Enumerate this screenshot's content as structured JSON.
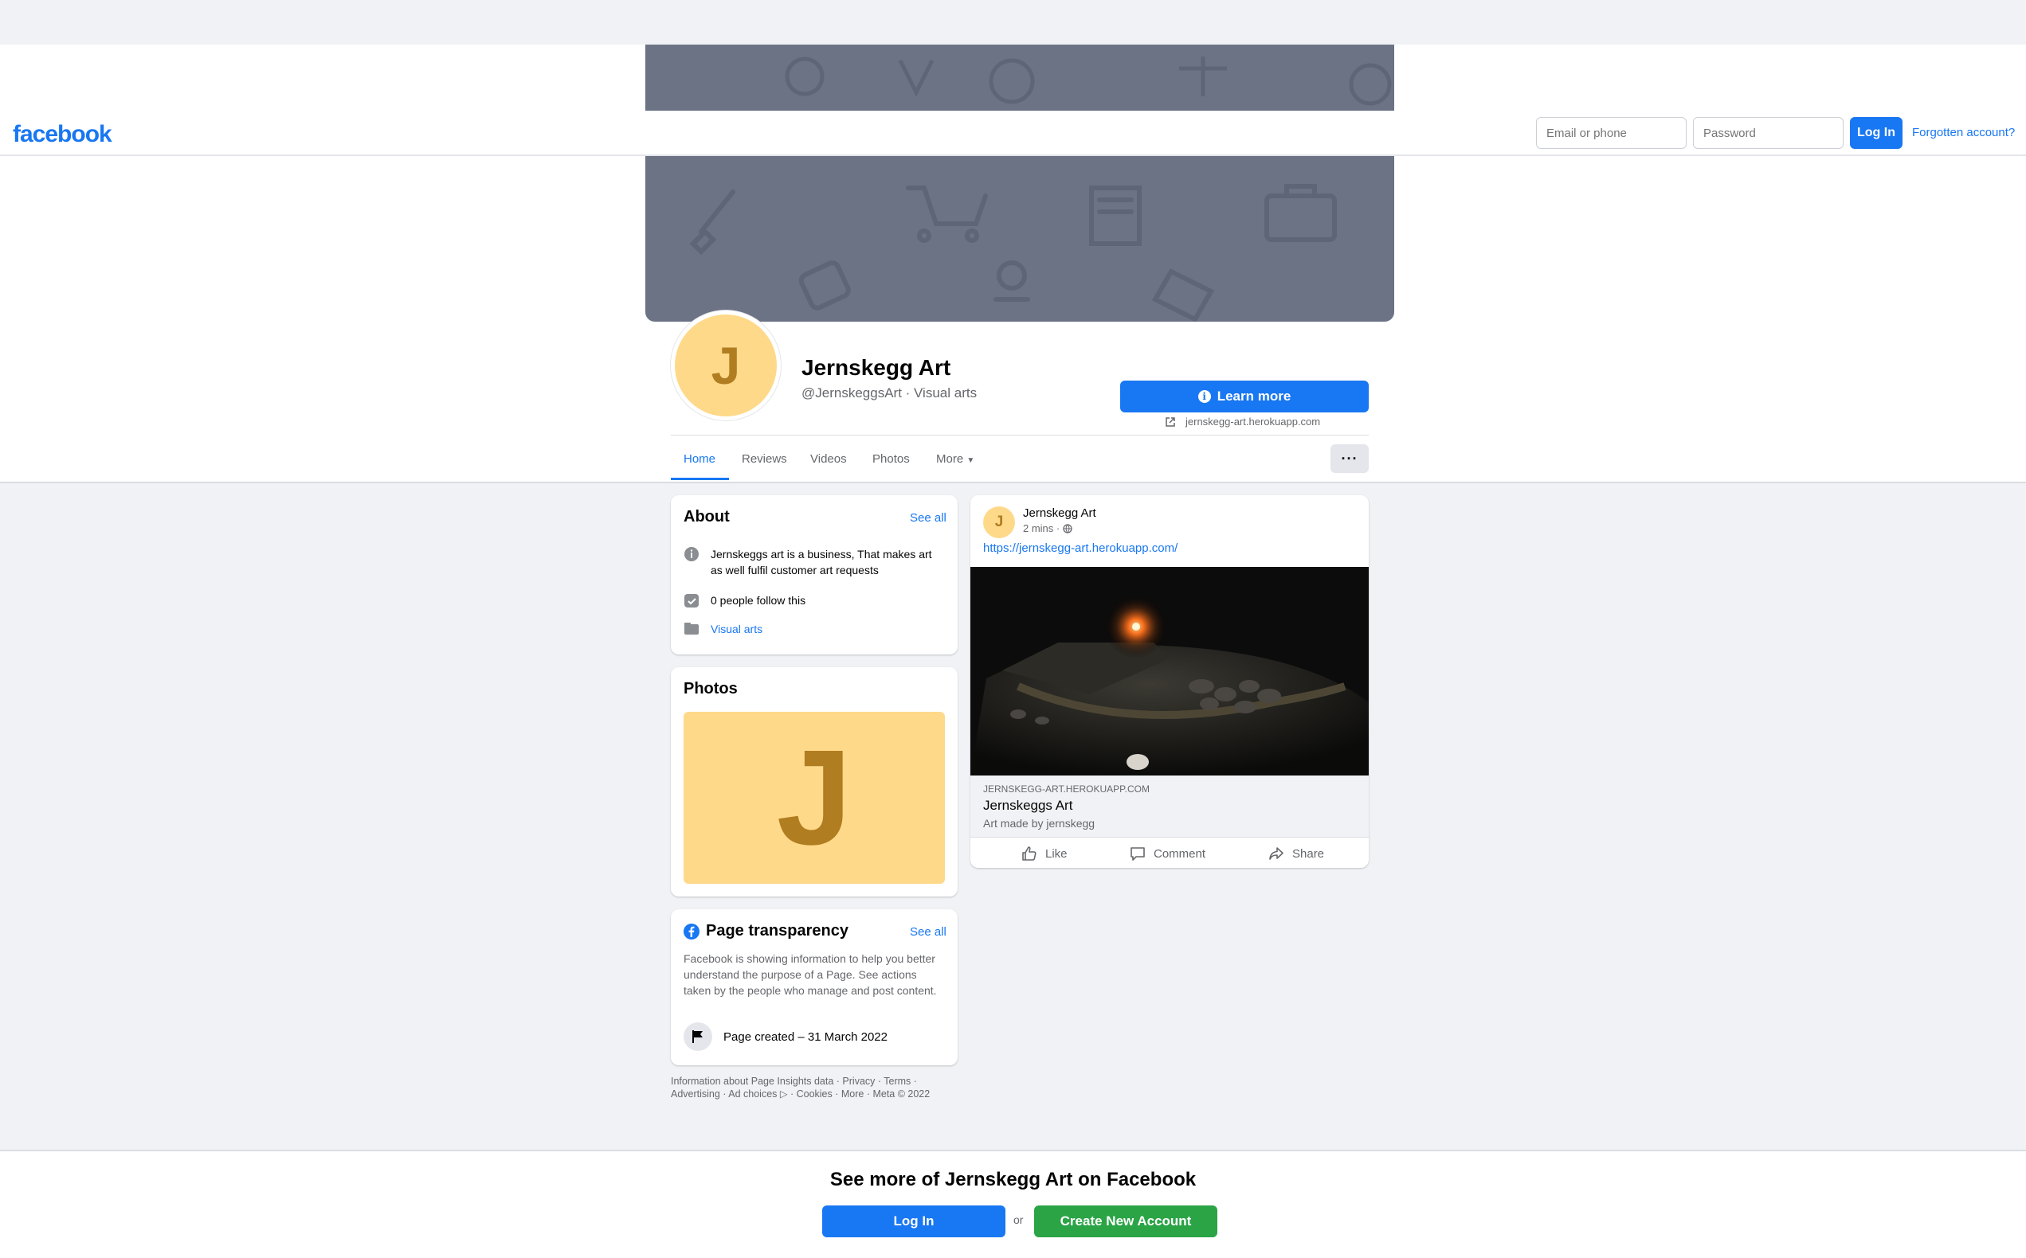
{
  "header": {
    "logo": "facebook",
    "email_placeholder": "Email or phone",
    "password_placeholder": "Password",
    "login_label": "Log In",
    "forgot_label": "Forgotten account?"
  },
  "profile": {
    "avatar_letter": "J",
    "name": "Jernskegg Art",
    "handle": "@JernskeggsArt · Visual arts",
    "learn_more_label": "Learn more",
    "website": "jernskegg-art.herokuapp.com"
  },
  "tabs": [
    {
      "label": "Home",
      "active": true
    },
    {
      "label": "Reviews"
    },
    {
      "label": "Videos"
    },
    {
      "label": "Photos"
    },
    {
      "label": "More"
    }
  ],
  "more_options_label": "···",
  "about": {
    "title": "About",
    "see_all": "See all",
    "description": "Jernskeggs art is a business, That makes art as well fulfil customer art requests",
    "followers": "0 people follow this",
    "category": "Visual arts"
  },
  "photos": {
    "title": "Photos",
    "thumb_letter": "J"
  },
  "transparency": {
    "title": "Page transparency",
    "see_all": "See all",
    "text": "Facebook is showing information to help you better understand the purpose of a Page. See actions taken by the people who manage and post content.",
    "page_created": "Page created – 31 March 2022"
  },
  "footer": {
    "line1": "Information about Page Insights data · Privacy · Terms ·",
    "line2": "Advertising · Ad choices ▷ · Cookies · More · Meta © 2022"
  },
  "post": {
    "avatar_letter": "J",
    "author": "Jernskegg Art",
    "time": "2 mins ·",
    "url": "https://jernskegg-art.herokuapp.com/",
    "preview_domain": "JERNSKEGG-ART.HEROKUAPP.COM",
    "preview_title": "Jernskeggs Art",
    "preview_desc": "Art made by jernskegg",
    "like": "Like",
    "comment": "Comment",
    "share": "Share"
  },
  "bottom": {
    "title": "See more of Jernskegg Art on Facebook",
    "login_label": "Log In",
    "or": "or",
    "create_label": "Create New Account"
  },
  "colors": {
    "brand": "#1877f2",
    "cover": "#6b7385",
    "avatar": "#ffd98a",
    "create_button": "#2ba446"
  }
}
